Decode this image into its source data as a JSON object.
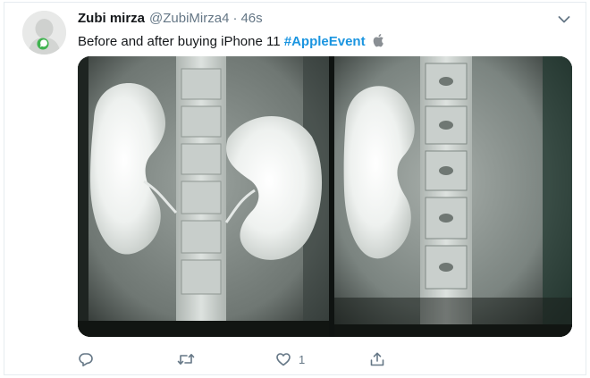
{
  "tweet": {
    "author_name": "Zubi mirza",
    "handle": "@ZubiMirza4",
    "separator": "·",
    "time": "46s",
    "text_plain": "Before and after buying iPhone 11 ",
    "hashtag": "#AppleEvent",
    "like_count": "1"
  },
  "media": {
    "description": "",
    "panels": 2
  },
  "icons": {
    "avatar": "whatsapp-avatar",
    "more": "chevron-down-icon",
    "reply": "reply-icon",
    "retweet": "retweet-icon",
    "like": "heart-icon",
    "share": "share-icon",
    "inline_emoji": "apple-logo-icon"
  },
  "colors": {
    "hashtag": "#1b95e0",
    "secondary_text": "#657786",
    "border": "#e6ecf0"
  }
}
